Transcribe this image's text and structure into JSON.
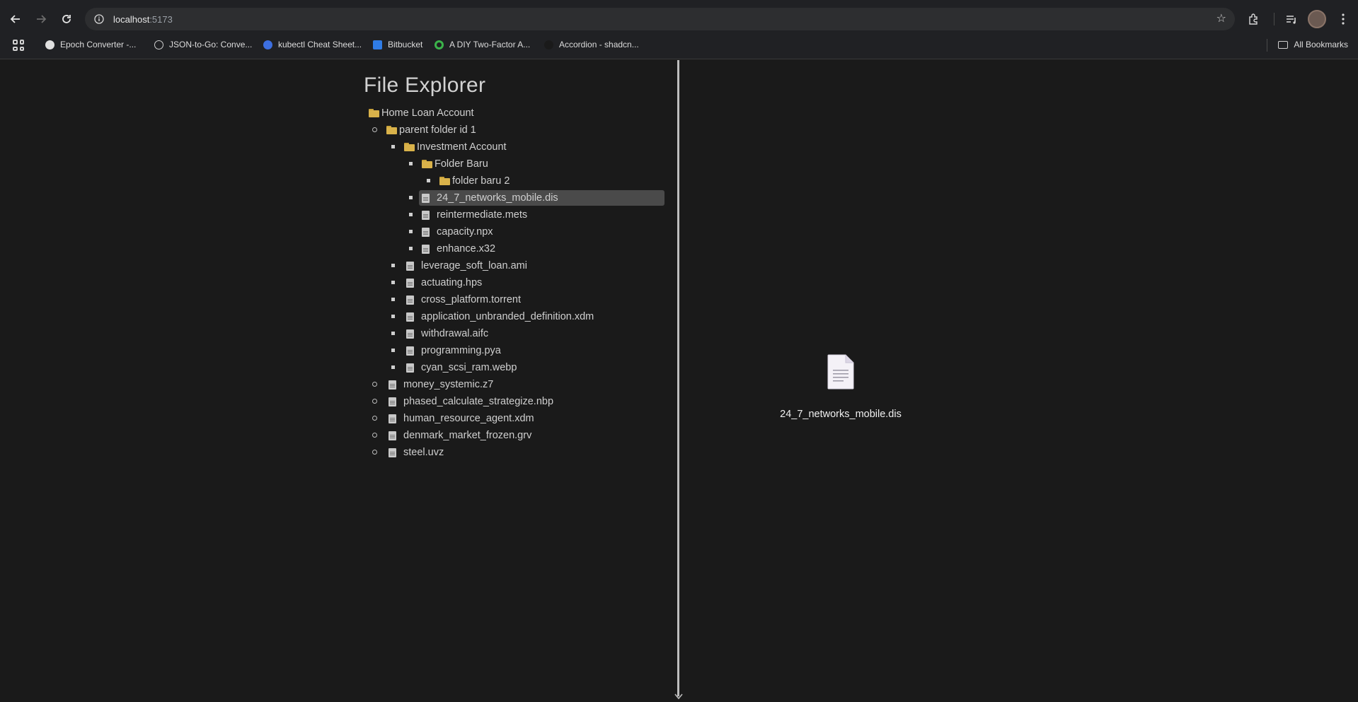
{
  "browser": {
    "url_host": "localhost",
    "url_port": ":5173",
    "bookmarks": [
      {
        "label": "Epoch Converter -...",
        "color": "#e0e0e0"
      },
      {
        "label": "JSON-to-Go: Conve...",
        "color": "#cfcfcf"
      },
      {
        "label": "kubectl Cheat Sheet...",
        "color": "#3d6fe0"
      },
      {
        "label": "Bitbucket",
        "color": "#2f7ce6"
      },
      {
        "label": "A DIY Two-Factor A...",
        "color": "#3bb44a"
      },
      {
        "label": "Accordion - shadcn...",
        "color": "#1a1a1a"
      }
    ],
    "all_bookmarks_label": "All Bookmarks"
  },
  "explorer": {
    "title": "File Explorer",
    "tree": [
      {
        "label": "Home Loan Account",
        "type": "folder",
        "depth": 0
      },
      {
        "label": "parent folder id 1",
        "type": "folder",
        "depth": 1
      },
      {
        "label": "Investment Account",
        "type": "folder",
        "depth": 2
      },
      {
        "label": "Folder Baru",
        "type": "folder",
        "depth": 3
      },
      {
        "label": "folder baru 2",
        "type": "folder",
        "depth": 4
      },
      {
        "label": "24_7_networks_mobile.dis",
        "type": "file",
        "depth": 3,
        "selected": true
      },
      {
        "label": "reintermediate.mets",
        "type": "file",
        "depth": 3
      },
      {
        "label": "capacity.npx",
        "type": "file",
        "depth": 3
      },
      {
        "label": "enhance.x32",
        "type": "file",
        "depth": 3
      },
      {
        "label": "leverage_soft_loan.ami",
        "type": "file",
        "depth": 2
      },
      {
        "label": "actuating.hps",
        "type": "file",
        "depth": 2
      },
      {
        "label": "cross_platform.torrent",
        "type": "file",
        "depth": 2
      },
      {
        "label": "application_unbranded_definition.xdm",
        "type": "file",
        "depth": 2
      },
      {
        "label": "withdrawal.aifc",
        "type": "file",
        "depth": 2
      },
      {
        "label": "programming.pya",
        "type": "file",
        "depth": 2
      },
      {
        "label": "cyan_scsi_ram.webp",
        "type": "file",
        "depth": 2
      },
      {
        "label": "money_systemic.z7",
        "type": "file",
        "depth": 1
      },
      {
        "label": "phased_calculate_strategize.nbp",
        "type": "file",
        "depth": 1
      },
      {
        "label": "human_resource_agent.xdm",
        "type": "file",
        "depth": 1
      },
      {
        "label": "denmark_market_frozen.grv",
        "type": "file",
        "depth": 1
      },
      {
        "label": "steel.uvz",
        "type": "file",
        "depth": 1
      }
    ]
  },
  "preview": {
    "file_name": "24_7_networks_mobile.dis",
    "icon": "file-text-icon"
  }
}
